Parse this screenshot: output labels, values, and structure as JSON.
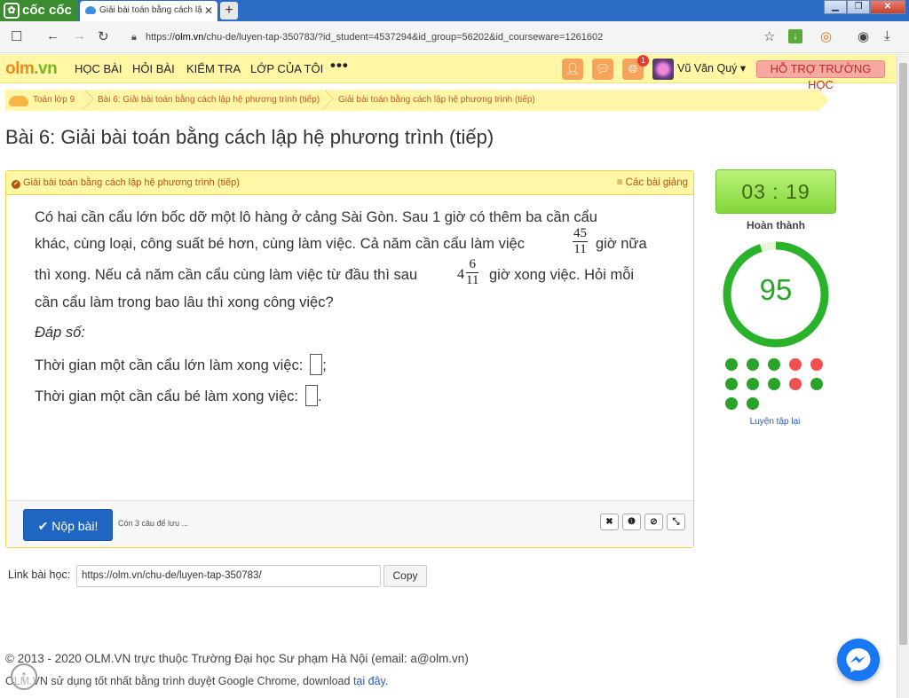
{
  "browser": {
    "brand": "cốc cốc",
    "tab_title": "Giải bài toán bằng cách lậ",
    "url_prefix": "https://",
    "url_host": "olm.vn",
    "url_path": "/chu-de/luyen-tap-350783/?id_student=4537294&id_group=56202&id_courseware=1261602"
  },
  "nav": {
    "logo_o": "olm",
    "logo_rest": ".vn",
    "items": [
      "HỌC BÀI",
      "HỎI BÀI",
      "KIỂM TRA",
      "LỚP CỦA TÔI"
    ],
    "more": "•••",
    "notification_count": "1",
    "user": "Vũ Văn Quý ▾",
    "support": "HỖ TRỢ TRƯỜNG HỌC"
  },
  "breadcrumb": [
    "Toán lớp 9",
    "Bài 6: Giải bài toán bằng cách lập hệ phương trình (tiếp)",
    "Giải bài toán bằng cách lập hệ phương trình (tiếp)"
  ],
  "page_title": "Bài 6: Giải bài toán bằng cách lập hệ phương trình (tiếp)",
  "panel": {
    "header_left": "Giải bài toán bằng cách lập hệ phương trình (tiếp)",
    "header_right": "≡ Các bài giảng",
    "question": {
      "line1": "Có hai cần cẩu lớn bốc dỡ một lô hàng ở cảng Sài Gòn. Sau 1 giờ có thêm ba cần cẩu",
      "line2a": "khác, cùng loại, công suất bé hơn, cùng làm việc. Cả năm cần cẩu làm việc",
      "line2b": "giờ nữa",
      "frac1_num": "45",
      "frac1_den": "11",
      "line3a": "thì xong. Nếu cả năm cần cẩu cùng làm việc từ đầu thì sau",
      "line3b": "giờ xong việc. Hỏi mỗi",
      "mixed_int": "4",
      "frac2_num": "6",
      "frac2_den": "11",
      "line4": "cần cẩu làm trong bao lâu thì xong công việc?",
      "answer_label": "Đáp số:",
      "ans1": "Thời gian một cần cẩu lớn làm xong việc:",
      "ans1_end": ";",
      "ans2": "Thời gian một cần cẩu bé làm xong việc:",
      "ans2_end": "."
    },
    "submit": "✔ Nộp bài!",
    "remaining": "Còn 3 câu để lưu ...",
    "tools": [
      "✖",
      "❶",
      "⊘",
      "⤡"
    ]
  },
  "link": {
    "label": "Link bài học:",
    "value": "https://olm.vn/chu-de/luyen-tap-350783/",
    "copy": "Copy"
  },
  "sidebar": {
    "timer": "03 : 19",
    "status": "Hoàn thành",
    "score": "95",
    "score_fraction": 0.95,
    "results": [
      "correct",
      "correct",
      "correct",
      "wrong",
      "wrong",
      "correct",
      "correct",
      "correct",
      "wrong",
      "correct",
      "correct",
      "correct"
    ],
    "retry": "Luyện tập lại"
  },
  "footer": {
    "line1": "© 2013 - 2020 OLM.VN trực thuộc Trường Đại học Sư phạm Hà Nội (email: a@olm.vn)",
    "line2": "OLM.VN sử dụng tốt nhất bằng trình duyệt Google Chrome, download",
    "line2_link": "tại đây",
    "line2_end": "."
  },
  "colors": {
    "accent_yellow": "#fff7a8",
    "correct": "#2aa32a",
    "wrong": "#f05050",
    "submit_blue": "#1e66c2"
  }
}
